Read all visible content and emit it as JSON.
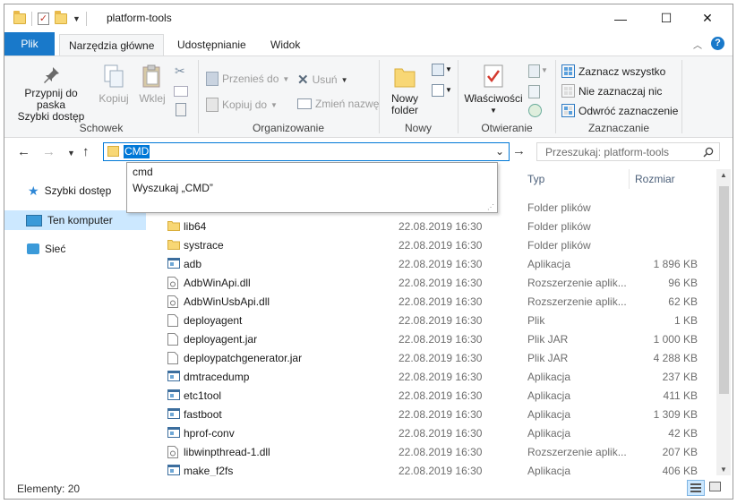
{
  "window": {
    "title": "platform-tools",
    "controls": {
      "minimize": "—",
      "maximize": "☐",
      "close": "✕"
    }
  },
  "ribbon": {
    "tabs": [
      "Plik",
      "Narzędzia główne",
      "Udostępnianie",
      "Widok"
    ],
    "active_tab": "Narzędzia główne",
    "groups": {
      "schowek": {
        "label": "Schowek",
        "pin_line1": "Przypnij do paska",
        "pin_line2": "Szybki dostęp",
        "copy": "Kopiuj",
        "paste": "Wklej"
      },
      "organizowanie": {
        "label": "Organizowanie",
        "move_to": "Przenieś do",
        "copy_to": "Kopiuj do",
        "delete": "Usuń",
        "rename": "Zmień nazwę"
      },
      "nowy": {
        "label": "Nowy",
        "new_folder_line1": "Nowy",
        "new_folder_line2": "folder"
      },
      "otwieranie": {
        "label": "Otwieranie",
        "properties": "Właściwości"
      },
      "zaznaczanie": {
        "label": "Zaznaczanie",
        "select_all": "Zaznacz wszystko",
        "select_none": "Nie zaznaczaj nic",
        "invert": "Odwróć zaznaczenie"
      }
    }
  },
  "address": {
    "value": "CMD",
    "search_placeholder": "Przeszukaj: platform-tools"
  },
  "autocomplete": [
    "cmd",
    "Wyszukaj „CMD”"
  ],
  "nav": {
    "items": [
      "Szybki dostęp",
      "Ten komputer",
      "Sieć"
    ],
    "selected": "Ten komputer"
  },
  "columns": {
    "type": "Typ",
    "size": "Rozmiar"
  },
  "files": [
    {
      "name": "lib64",
      "date": "22.08.2019 16:30",
      "type": "Folder plików",
      "size": "",
      "icon": "folder-icon"
    },
    {
      "name": "systrace",
      "date": "22.08.2019 16:30",
      "type": "Folder plików",
      "size": "",
      "icon": "folder-icon"
    },
    {
      "name": "adb",
      "date": "22.08.2019 16:30",
      "type": "Aplikacja",
      "size": "1 896 KB",
      "icon": "app-icon"
    },
    {
      "name": "AdbWinApi.dll",
      "date": "22.08.2019 16:30",
      "type": "Rozszerzenie aplik...",
      "size": "96 KB",
      "icon": "dll-icon"
    },
    {
      "name": "AdbWinUsbApi.dll",
      "date": "22.08.2019 16:30",
      "type": "Rozszerzenie aplik...",
      "size": "62 KB",
      "icon": "dll-icon"
    },
    {
      "name": "deployagent",
      "date": "22.08.2019 16:30",
      "type": "Plik",
      "size": "1 KB",
      "icon": "file-icon"
    },
    {
      "name": "deployagent.jar",
      "date": "22.08.2019 16:30",
      "type": "Plik JAR",
      "size": "1 000 KB",
      "icon": "file-icon"
    },
    {
      "name": "deploypatchgenerator.jar",
      "date": "22.08.2019 16:30",
      "type": "Plik JAR",
      "size": "4 288 KB",
      "icon": "file-icon"
    },
    {
      "name": "dmtracedump",
      "date": "22.08.2019 16:30",
      "type": "Aplikacja",
      "size": "237 KB",
      "icon": "app-icon"
    },
    {
      "name": "etc1tool",
      "date": "22.08.2019 16:30",
      "type": "Aplikacja",
      "size": "411 KB",
      "icon": "app-icon"
    },
    {
      "name": "fastboot",
      "date": "22.08.2019 16:30",
      "type": "Aplikacja",
      "size": "1 309 KB",
      "icon": "app-icon"
    },
    {
      "name": "hprof-conv",
      "date": "22.08.2019 16:30",
      "type": "Aplikacja",
      "size": "42 KB",
      "icon": "app-icon"
    },
    {
      "name": "libwinpthread-1.dll",
      "date": "22.08.2019 16:30",
      "type": "Rozszerzenie aplik...",
      "size": "207 KB",
      "icon": "dll-icon"
    },
    {
      "name": "make_f2fs",
      "date": "22.08.2019 16:30",
      "type": "Aplikacja",
      "size": "406 KB",
      "icon": "app-icon"
    }
  ],
  "first_row_type": "Folder plików",
  "status": {
    "items": "Elementy: 20"
  },
  "colors": {
    "accent": "#0078d7",
    "file_tab": "#1979ca",
    "nav_selected": "#cce8ff"
  }
}
